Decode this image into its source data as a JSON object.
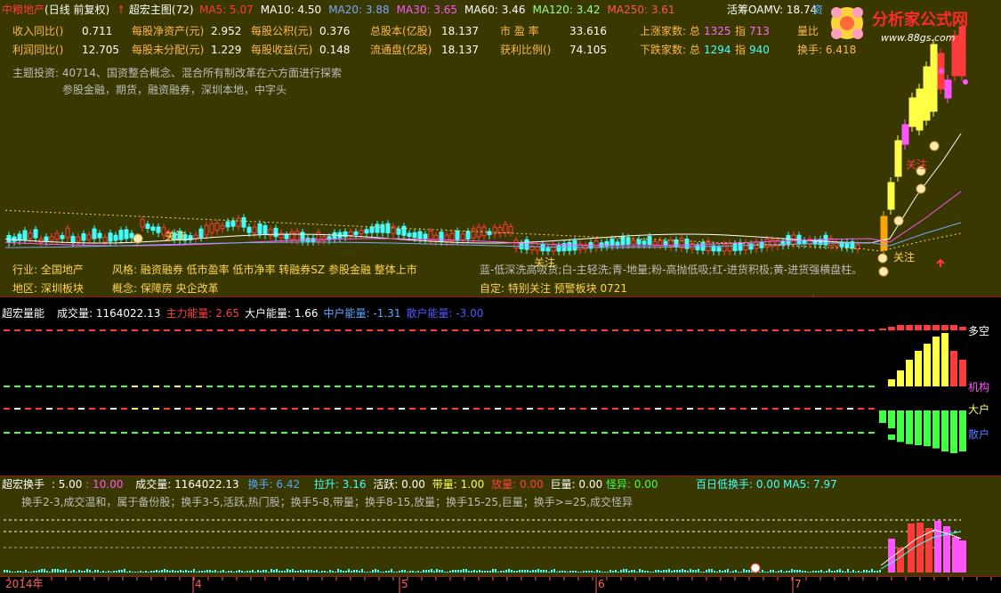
{
  "header": {
    "stock_name": "中粮地产",
    "period": "(日线 前复权)",
    "arrow_icon": "red-up-arrow",
    "indicator": "超宏主图(72)",
    "ma": [
      {
        "label": "MA5: 5.07",
        "color": "#ff3b3b"
      },
      {
        "label": "MA10: 4.50",
        "color": "#ffffff"
      },
      {
        "label": "MA20: 3.88",
        "color": "#7aa7ff"
      },
      {
        "label": "MA30: 3.65",
        "color": "#ff55ff"
      },
      {
        "label": "MA60: 3.46",
        "color": "#ffffff"
      },
      {
        "label": "MA120: 3.42",
        "color": "#9aff9a"
      },
      {
        "label": "MA250: 3.61",
        "color": "#ff5555"
      }
    ],
    "oamv": "活筹OAMV: 18.74",
    "oamv_tail": "资"
  },
  "logo": {
    "text": "分析家公式网",
    "url": "www.88gs.com"
  },
  "fin": {
    "r1": [
      {
        "k": "收入同比()",
        "v": "0.711"
      },
      {
        "k": "每股净资产(元)",
        "v": "2.952"
      },
      {
        "k": "每股公积(元)",
        "v": "0.376"
      },
      {
        "k": "总股本(亿股)",
        "v": "18.137"
      },
      {
        "k": "市    盈    率",
        "v": "33.616"
      }
    ],
    "r2": [
      {
        "k": "利润同比()",
        "v": "12.705"
      },
      {
        "k": "每股未分配(元)",
        "v": "1.229"
      },
      {
        "k": "每股收益(元)",
        "v": "0.148"
      },
      {
        "k": "流通盘(亿股)",
        "v": "18.137"
      },
      {
        "k": "获利比例()",
        "v": "74.105"
      }
    ],
    "up_label": "上涨家数: 总",
    "up_total": "1325",
    "up_idx_label": "指",
    "up_idx": "713",
    "down_label": "下跌家数: 总",
    "down_total": "1294",
    "down_idx_label": "指",
    "down_idx": "940",
    "liangbi": "量比",
    "huanshou": "换手: 6.418"
  },
  "theme": {
    "line1": "主题投资: 40714、国资整合概念、混合所有制改革在六方面进行探索",
    "line2": "参股金融，期货，融资融券，深圳本地，中字头"
  },
  "info": {
    "industry": "行业: 全国地产",
    "style": "风格: 融资融券 低市盈率 低市净率 转融券SZ 参股金融 整体上市",
    "region": "地区: 深圳板块",
    "concept": "概念: 保障房 央企改革",
    "legend": "蓝-低深洗高吸货;白-主轻洗;青-地量;粉-高抛低吸;红-进货积极;黄-进货强横盘柱。",
    "custom": "自定: 特别关注 预警板块 0721"
  },
  "marks": {
    "guanzhu": "关注",
    "dollar": "$"
  },
  "energy": {
    "title": "超宏量能",
    "items": [
      {
        "t": "成交量: 1164022.13",
        "c": "#ffffff"
      },
      {
        "t": "主力能量: 2.65",
        "c": "#ff4040"
      },
      {
        "t": "大户能量: 1.66",
        "c": "#ffffff"
      },
      {
        "t": "中户能量: -1.31",
        "c": "#55aaff"
      },
      {
        "t": "散户能量: -3.00",
        "c": "#5555ff"
      }
    ],
    "labels": {
      "duokong": "多空",
      "jigou": "机构",
      "dahu": "大户",
      "sanhu": "散户"
    }
  },
  "turnover": {
    "title": "超宏换手",
    "a": ": 5.00",
    "b": ": 10.00",
    "vol": "成交量: 1164022.13",
    "hs": "换手: 6.42",
    "ls": "拉升: 3.16",
    "hy": "活跃: 0.00",
    "dl": "带量: 1.00",
    "fl": "放量: 0.00",
    "jl": "巨量: 0.00",
    "gy": "怪异: 0.00",
    "bairi": "百日低换手: 0.00",
    "ma5": "MA5: 7.97",
    "desc": "换手2-3,成交温和，属于备份股；换手3-5,活跃,热门股；换手5-8,带量；换手8-15,放量；换手15-25,巨量；换手>=25,成交怪异"
  },
  "dates": {
    "year": "2014年",
    "m4": "4",
    "m5": "5",
    "m6": "6",
    "m7": "7"
  }
}
